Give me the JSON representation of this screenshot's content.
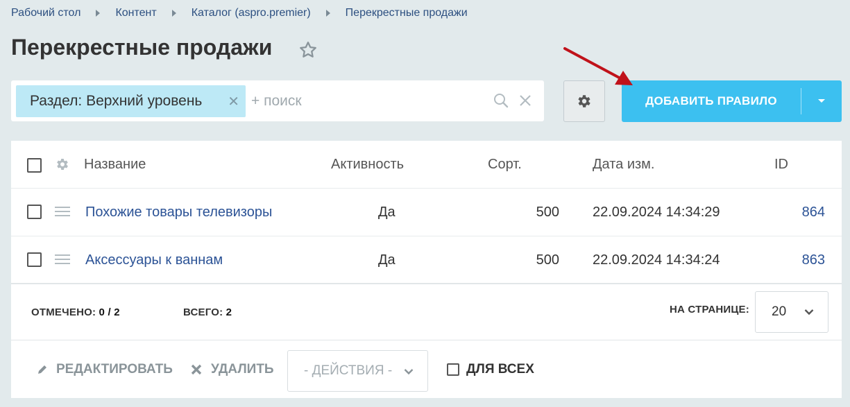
{
  "breadcrumb": [
    "Рабочий стол",
    "Контент",
    "Каталог (aspro.premier)",
    "Перекрестные продажи"
  ],
  "page_title": "Перекрестные продажи",
  "filter": {
    "tag_label": "Раздел: Верхний уровень",
    "search_placeholder": "+ поиск"
  },
  "toolbar": {
    "add_label": "ДОБАВИТЬ ПРАВИЛО"
  },
  "colors": {
    "accent": "#3cc0f0",
    "filter_tag": "#bde9f6",
    "link": "#2c5396",
    "arrow": "#c0121a"
  },
  "table": {
    "headers": {
      "name": "Название",
      "active": "Активность",
      "sort": "Сорт.",
      "date": "Дата изм.",
      "id": "ID"
    },
    "rows": [
      {
        "name": "Похожие товары телевизоры",
        "active": "Да",
        "sort": "500",
        "date": "22.09.2024 14:34:29",
        "id": "864"
      },
      {
        "name": "Аксессуары к ваннам",
        "active": "Да",
        "sort": "500",
        "date": "22.09.2024 14:34:24",
        "id": "863"
      }
    ]
  },
  "footer": {
    "selected_label": "ОТМЕЧЕНО:",
    "selected_value": "0 / 2",
    "total_label": "ВСЕГО:",
    "total_value": "2",
    "per_page_label": "НА СТРАНИЦЕ:",
    "per_page_value": "20"
  },
  "actions": {
    "edit_label": "РЕДАКТИРОВАТЬ",
    "delete_label": "УДАЛИТЬ",
    "actions_select": "- ДЕЙСТВИЯ -",
    "for_all_label": "ДЛЯ ВСЕХ"
  },
  "icons": [
    "star-icon",
    "close-icon",
    "search-icon",
    "clear-icon",
    "gear-icon",
    "chevron-down-icon",
    "drag-handle-icon",
    "pencil-icon",
    "delete-icon"
  ]
}
